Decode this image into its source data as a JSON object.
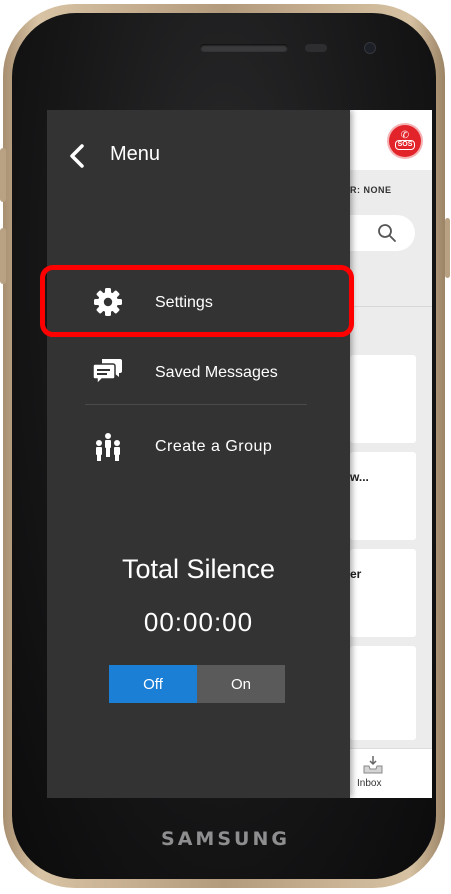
{
  "device": {
    "brand": "SAMSUNG"
  },
  "background_app": {
    "sos_label": "SOS",
    "filter_label": "R: NONE",
    "cards": [
      {
        "text": ""
      },
      {
        "text": "w..."
      },
      {
        "text": "er"
      },
      {
        "text": ""
      }
    ],
    "bottom_nav": {
      "inbox_label": "Inbox"
    }
  },
  "drawer": {
    "title": "Menu",
    "items": [
      {
        "label": "Settings",
        "icon": "gear-icon"
      },
      {
        "label": "Saved Messages",
        "icon": "chat-bubbles-icon"
      },
      {
        "label": "Create a Group",
        "icon": "group-icon"
      }
    ],
    "total_silence": {
      "title": "Total Silence",
      "timer": "00:00:00",
      "off_label": "Off",
      "on_label": "On",
      "selected": "Off"
    }
  },
  "colors": {
    "drawer_bg": "#333333",
    "accent_blue": "#1c7fd6",
    "highlight_red": "#ff0000",
    "sos_red": "#e2232a"
  }
}
